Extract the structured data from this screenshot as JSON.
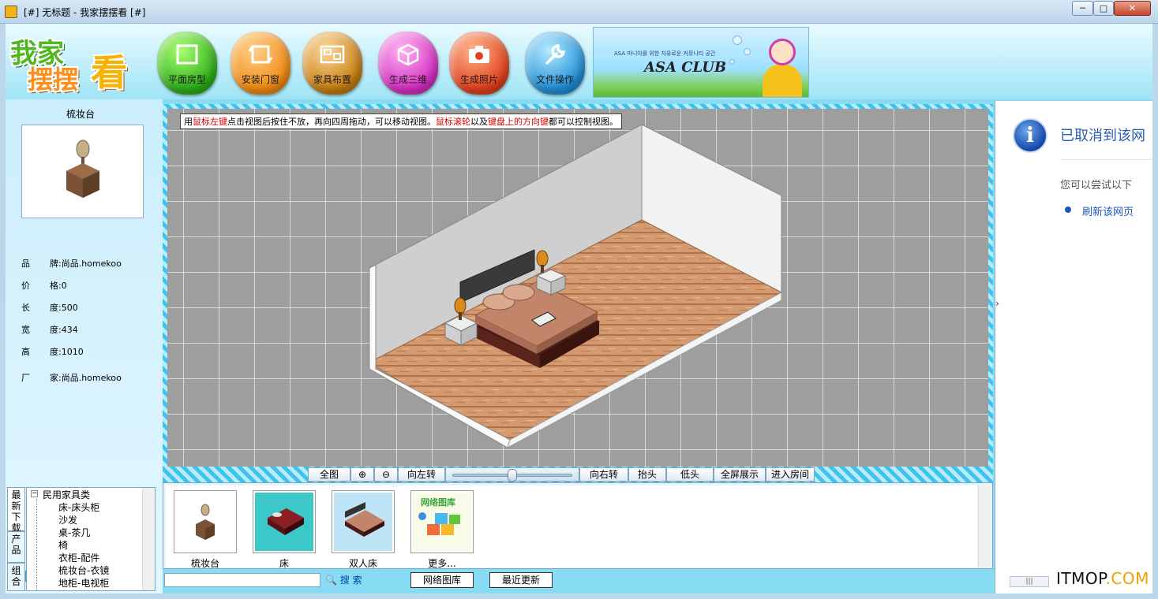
{
  "window": {
    "title": "[#] 无标题 - 我家摆摆看 [#]",
    "min_glyph": "─",
    "max_glyph": "□",
    "close_glyph": "✕"
  },
  "logo": {
    "line1": "我家",
    "line2": "摆摆",
    "line3": "看"
  },
  "nav": [
    {
      "label": "平面房型",
      "icon": "floor-plan-icon"
    },
    {
      "label": "安装门窗",
      "icon": "door-window-icon"
    },
    {
      "label": "家具布置",
      "icon": "furniture-layout-icon"
    },
    {
      "label": "生成三维",
      "icon": "cube-icon"
    },
    {
      "label": "生成照片",
      "icon": "camera-icon"
    },
    {
      "label": "文件操作",
      "icon": "wrench-icon"
    }
  ],
  "banner": {
    "small": "ASA 마니아를 위한 자유로운 커뮤니티 공간",
    "big": "ASA CLUB"
  },
  "product": {
    "title": "梳妆台",
    "props": [
      {
        "key": "品",
        "key2": "牌:",
        "value": "尚品.homekoo"
      },
      {
        "key": "价",
        "key2": "格:",
        "value": "0"
      },
      {
        "key": "长",
        "key2": "度:",
        "value": "500"
      },
      {
        "key": "宽",
        "key2": "度:",
        "value": "434"
      },
      {
        "key": "高",
        "key2": "度:",
        "value": "1010"
      },
      {
        "key": "厂",
        "key2": "家:",
        "value": "尚品.homekoo"
      }
    ]
  },
  "tabs": {
    "new": "最新下载",
    "products": "产品",
    "combos": "组合"
  },
  "tree": {
    "root": "民用家具类",
    "expander": "−",
    "items": [
      "床-床头柜",
      "沙发",
      "桌-茶几",
      "椅",
      "衣柜-配件",
      "梳妆台-衣镜",
      "地柜-电视柜"
    ]
  },
  "canvas": {
    "hint_parts": [
      {
        "text": "用",
        "red": false
      },
      {
        "text": "鼠标左键",
        "red": true
      },
      {
        "text": "点击视图后按住不放，再向四周拖动，可以移动视图。",
        "red": false
      },
      {
        "text": "鼠标滚轮",
        "red": true
      },
      {
        "text": "以及",
        "red": false
      },
      {
        "text": "键盘上的方向键",
        "red": true
      },
      {
        "text": "都可以控制视图。",
        "red": false
      }
    ]
  },
  "viewbar": {
    "full": "全图",
    "zoom_in_glyph": "⊕",
    "zoom_out_glyph": "⊖",
    "rotate_left": "向左转",
    "rotate_right": "向右转",
    "tilt_up": "抬头",
    "tilt_down": "低头",
    "fullscreen": "全屏展示",
    "enter_room": "进入房间",
    "slider_value": 0.5
  },
  "gallery": {
    "items": [
      {
        "label": "梳妆台"
      },
      {
        "label": "床"
      },
      {
        "label": "双人床"
      },
      {
        "label": "更多...",
        "img_text": "网络图库"
      }
    ]
  },
  "search": {
    "placeholder": "",
    "button": "搜 索",
    "gallery_btn": "网络图库",
    "recent_btn": "最近更新"
  },
  "rightpanel": {
    "title": "已取消到该网",
    "subtitle": "您可以尝试以下",
    "link": "刷新该网页",
    "collapse_glyph": "›",
    "hscroll_glyph": "|||"
  },
  "watermark": {
    "main": "ITMOP",
    "suffix": ".COM"
  },
  "colors": {
    "accent": "#87dcf3",
    "hint_red": "#d40000",
    "link": "#1d57b8"
  }
}
